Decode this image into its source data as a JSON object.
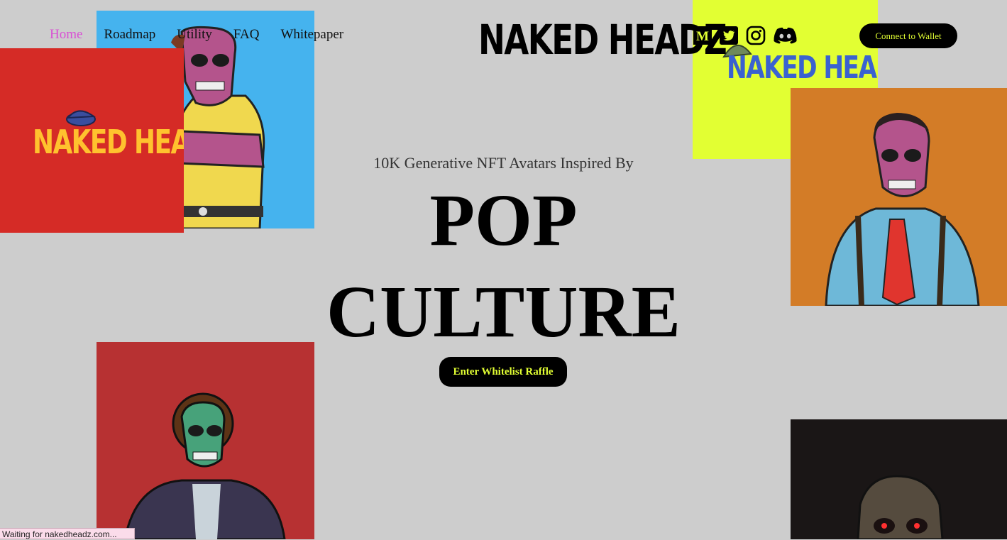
{
  "nav": {
    "items": [
      {
        "label": "Home",
        "active": true
      },
      {
        "label": "Roadmap",
        "active": false
      },
      {
        "label": "Utility",
        "active": false
      },
      {
        "label": "FAQ",
        "active": false
      },
      {
        "label": "Whitepaper",
        "active": false
      }
    ]
  },
  "brand": {
    "name": "NAKED HEADZ"
  },
  "social": {
    "icons": [
      "medium-icon",
      "twitter-icon",
      "instagram-icon",
      "discord-icon"
    ],
    "medium_glyph": "M"
  },
  "wallet": {
    "label": "Connect to Wallet"
  },
  "hero": {
    "subtitle": "10K Generative NFT Avatars Inspired By",
    "line1": "POP",
    "line2": "CULTURE",
    "cta": "Enter Whitelist Raffle"
  },
  "cards": {
    "red_logo": "NAKED HEADZ",
    "yellow_logo": "NAKED HEADZ"
  },
  "colors": {
    "background": "#cdcdcd",
    "accent": "#e2ff33",
    "nav_active": "#d94fd4",
    "card_blue": "#45b3ee",
    "card_red": "#d52b26",
    "card_yellow": "#e2ff33",
    "card_orange": "#d37c27",
    "card_crimson": "#b73132",
    "card_black": "#1a1616"
  },
  "status_bar": {
    "text": "Waiting for nakedheadz.com..."
  }
}
